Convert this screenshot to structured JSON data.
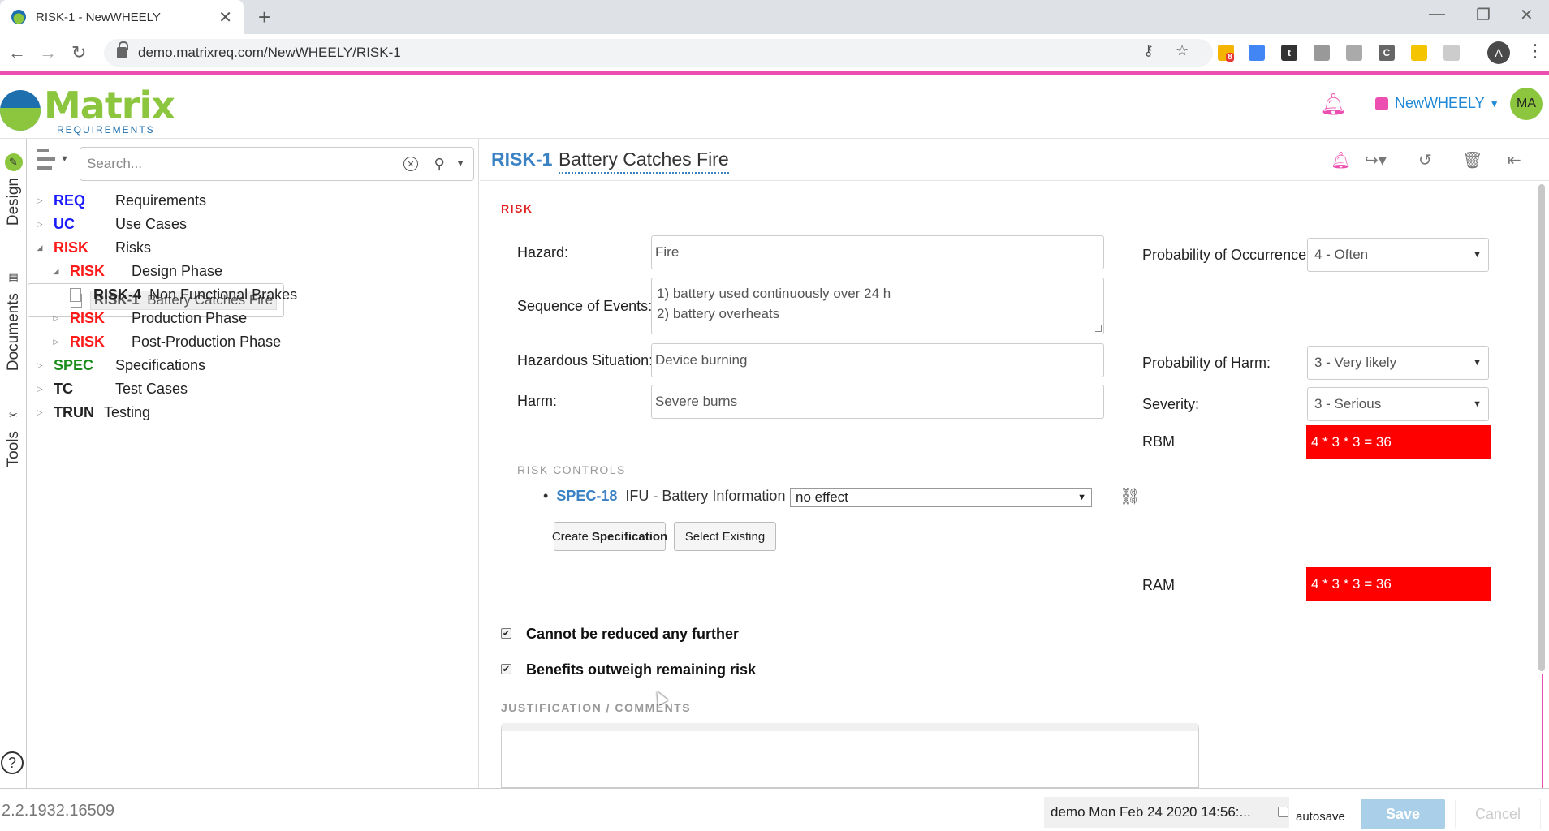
{
  "browser": {
    "tab_title": "RISK-1 - NewWHEELY",
    "url": "demo.matrixreq.com/NewWHEELY/RISK-1",
    "profile_initial": "A",
    "ext_badge": "8",
    "ext_c": "C"
  },
  "header": {
    "logo_word": "Matrix",
    "logo_sub": "REQUIREMENTS",
    "project": "NewWHEELY",
    "user_initials": "MA"
  },
  "rail": {
    "design": "Design",
    "documents": "Documents",
    "tools": "Tools",
    "help": "?"
  },
  "tree": {
    "search_placeholder": "Search...",
    "rows": [
      {
        "cat": "REQ",
        "label": "Requirements",
        "color": "#1a1aff"
      },
      {
        "cat": "UC",
        "label": "Use Cases",
        "color": "#1a1aff"
      },
      {
        "cat": "RISK",
        "label": "Risks",
        "color": "#ff1a1a"
      },
      {
        "cat": "RISK",
        "label": "Design Phase",
        "color": "#ff1a1a"
      },
      {
        "cat": "RISK-1",
        "label": "Battery Catches Fire"
      },
      {
        "cat": "RISK-4",
        "label": "Non Functional Brakes"
      },
      {
        "cat": "RISK",
        "label": "Production Phase",
        "color": "#ff1a1a"
      },
      {
        "cat": "RISK",
        "label": "Post-Production Phase",
        "color": "#ff1a1a"
      },
      {
        "cat": "SPEC",
        "label": "Specifications",
        "color": "#1a8c1a"
      },
      {
        "cat": "TC",
        "label": "Test Cases"
      },
      {
        "cat": "TRUN",
        "label": "Testing"
      }
    ]
  },
  "item": {
    "id": "RISK-1",
    "title": "Battery Catches Fire",
    "section": "RISK",
    "hazard_label": "Hazard:",
    "hazard": "Fire",
    "seq_label": "Sequence of Events:",
    "seq_line1": "1) battery used continuously over 24 h",
    "seq_line2": "2) battery overheats",
    "situation_label": "Hazardous Situation:",
    "situation": "Device burning",
    "harm_label": "Harm:",
    "harm": "Severe burns",
    "poo_label": "Probability of Occurrence:",
    "poo": "4 - Often",
    "poh_label": "Probability of Harm:",
    "poh": "3 - Very likely",
    "severity_label": "Severity:",
    "severity": "3 - Serious",
    "rbm_label": "RBM",
    "rbm": "4 * 3 * 3 = 36",
    "rc_section": "RISK CONTROLS",
    "rc_id": "SPEC-18",
    "rc_name": "IFU - Battery Information",
    "rc_effect": "no effect",
    "create_spec_pre": "Create",
    "create_spec_bold": "Specification",
    "select_existing": "Select Existing",
    "ram_label": "RAM",
    "ram": "4 * 3 * 3 = 36",
    "cb1": "Cannot be reduced any further",
    "cb2": "Benefits outweigh remaining risk",
    "justification": "JUSTIFICATION / COMMENTS"
  },
  "footer": {
    "version": "2.2.1932.16509",
    "last_save": "demo Mon Feb 24 2020 14:56:...",
    "autosave": "autosave",
    "save": "Save",
    "cancel": "Cancel"
  }
}
